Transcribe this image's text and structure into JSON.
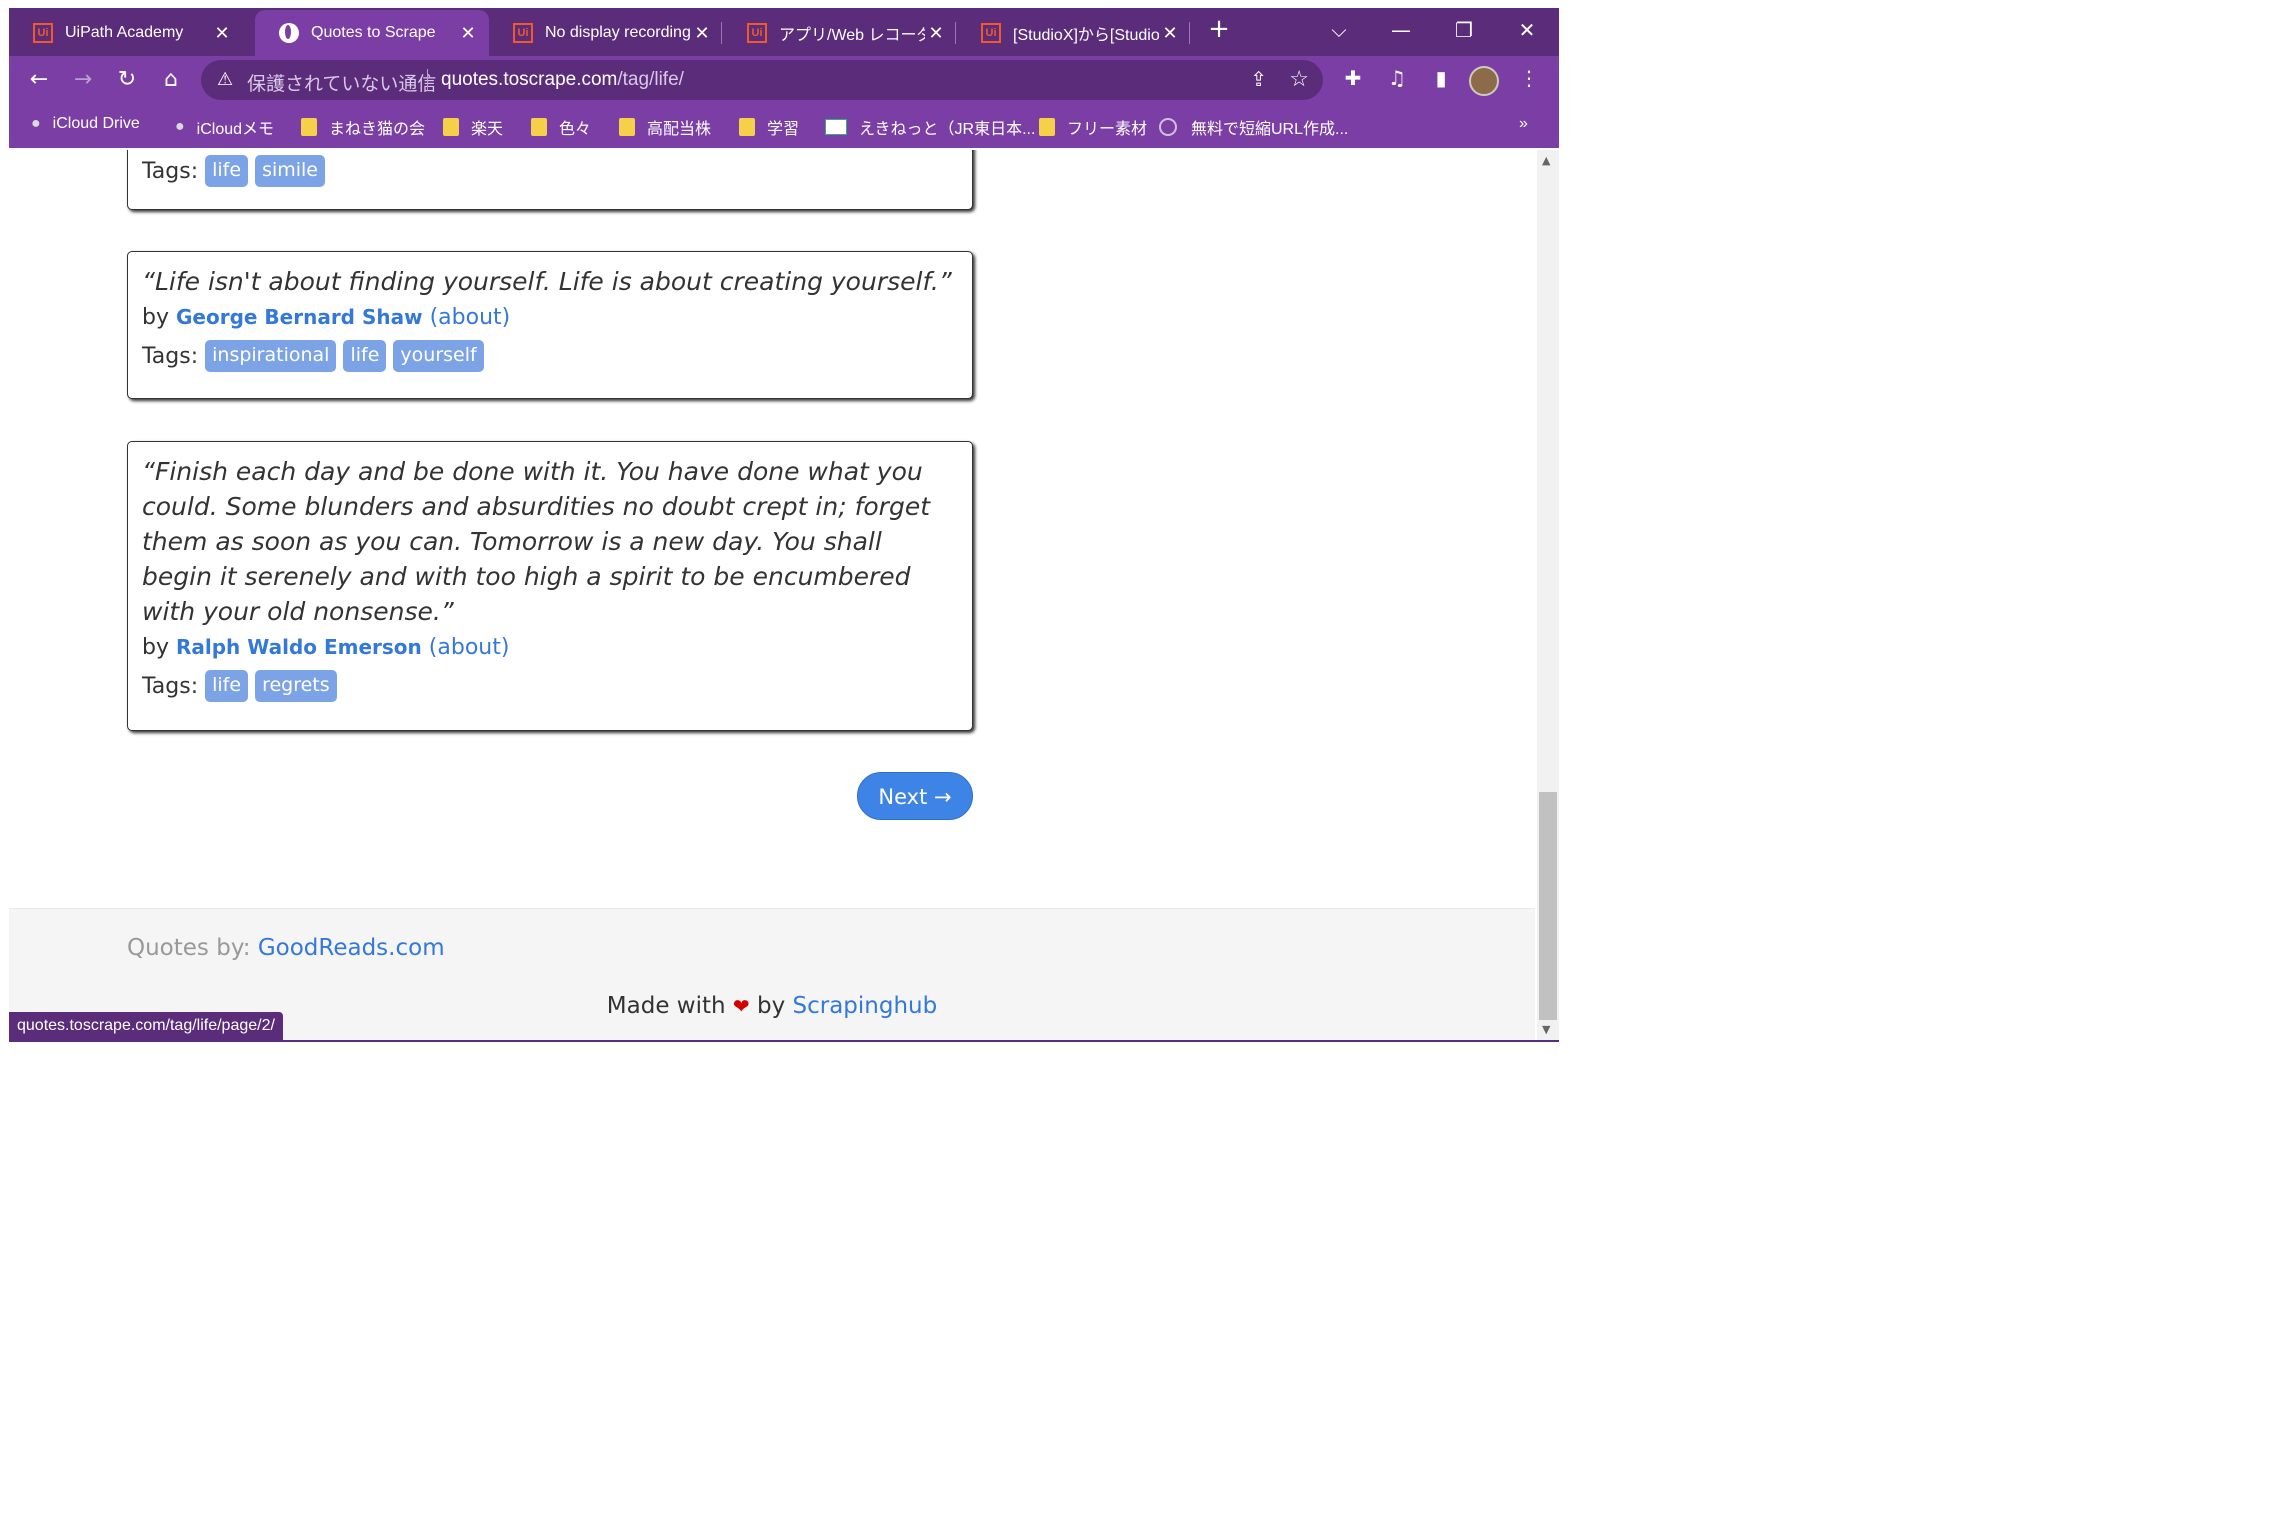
{
  "browser": {
    "tabs": [
      {
        "title": "UiPath Academy",
        "icon": "uipath-icon",
        "active": false
      },
      {
        "title": "Quotes to Scrape",
        "icon": "globe-icon",
        "active": true
      },
      {
        "title": "No display recording",
        "icon": "uipath-icon",
        "active": false
      },
      {
        "title": "アプリ/Web レコーダー",
        "icon": "uipath-icon",
        "active": false
      },
      {
        "title": "[StudioX]から[Studio",
        "icon": "uipath-icon",
        "active": false
      }
    ],
    "new_tab_label": "+",
    "ui_icon_text": "Ui",
    "security_label": "保護されていない通信",
    "url_host": "quotes.toscrape.com",
    "url_path": "/tag/life/",
    "bookmarks": [
      {
        "label": "iCloud Drive",
        "icon": "apple-icon"
      },
      {
        "label": "iCloudメモ",
        "icon": "apple-icon"
      },
      {
        "label": "まねき猫の会",
        "icon": "folder-icon"
      },
      {
        "label": "楽天",
        "icon": "folder-icon"
      },
      {
        "label": "色々",
        "icon": "folder-icon"
      },
      {
        "label": "高配当株",
        "icon": "folder-icon"
      },
      {
        "label": "学習",
        "icon": "folder-icon"
      },
      {
        "label": "えきねっと（JR東日本...",
        "icon": "ekinet-icon"
      },
      {
        "label": "フリー素材",
        "icon": "folder-icon"
      },
      {
        "label": "無料で短縮URL作成...",
        "icon": "link-icon"
      }
    ],
    "bookmarks_overflow": "»",
    "status_url": "quotes.toscrape.com/tag/life/page/2/"
  },
  "page": {
    "quotes": [
      {
        "text": "",
        "author": "",
        "tags": [
          "life",
          "simile"
        ]
      },
      {
        "text": "“Life isn't about finding yourself. Life is about creating yourself.”",
        "author": "George Bernard Shaw",
        "tags": [
          "inspirational",
          "life",
          "yourself"
        ]
      },
      {
        "text": "“Finish each day and be done with it. You have done what you could. Some blunders and absurdities no doubt crept in; forget them as soon as you can. Tomorrow is a new day. You shall begin it serenely and with too high a spirit to be encumbered with your old nonsense.”",
        "author": "Ralph Waldo Emerson",
        "tags": [
          "life",
          "regrets"
        ]
      }
    ],
    "by_label": "by",
    "about_label": "(about)",
    "tags_label": "Tags:",
    "next_label": "Next →",
    "footer": {
      "quotes_by_label": "Quotes by:",
      "quotes_by_link": "GoodReads.com",
      "made_with": "Made with",
      "heart": "❤",
      "by": "by",
      "made_by_link": "Scrapinghub"
    }
  },
  "colors": {
    "chrome_dark": "#5b2c7a",
    "chrome_light": "#7b3ea5",
    "link": "#3478d9",
    "tag_bg": "#7ca3e6",
    "next_bg": "#3e83e6"
  }
}
